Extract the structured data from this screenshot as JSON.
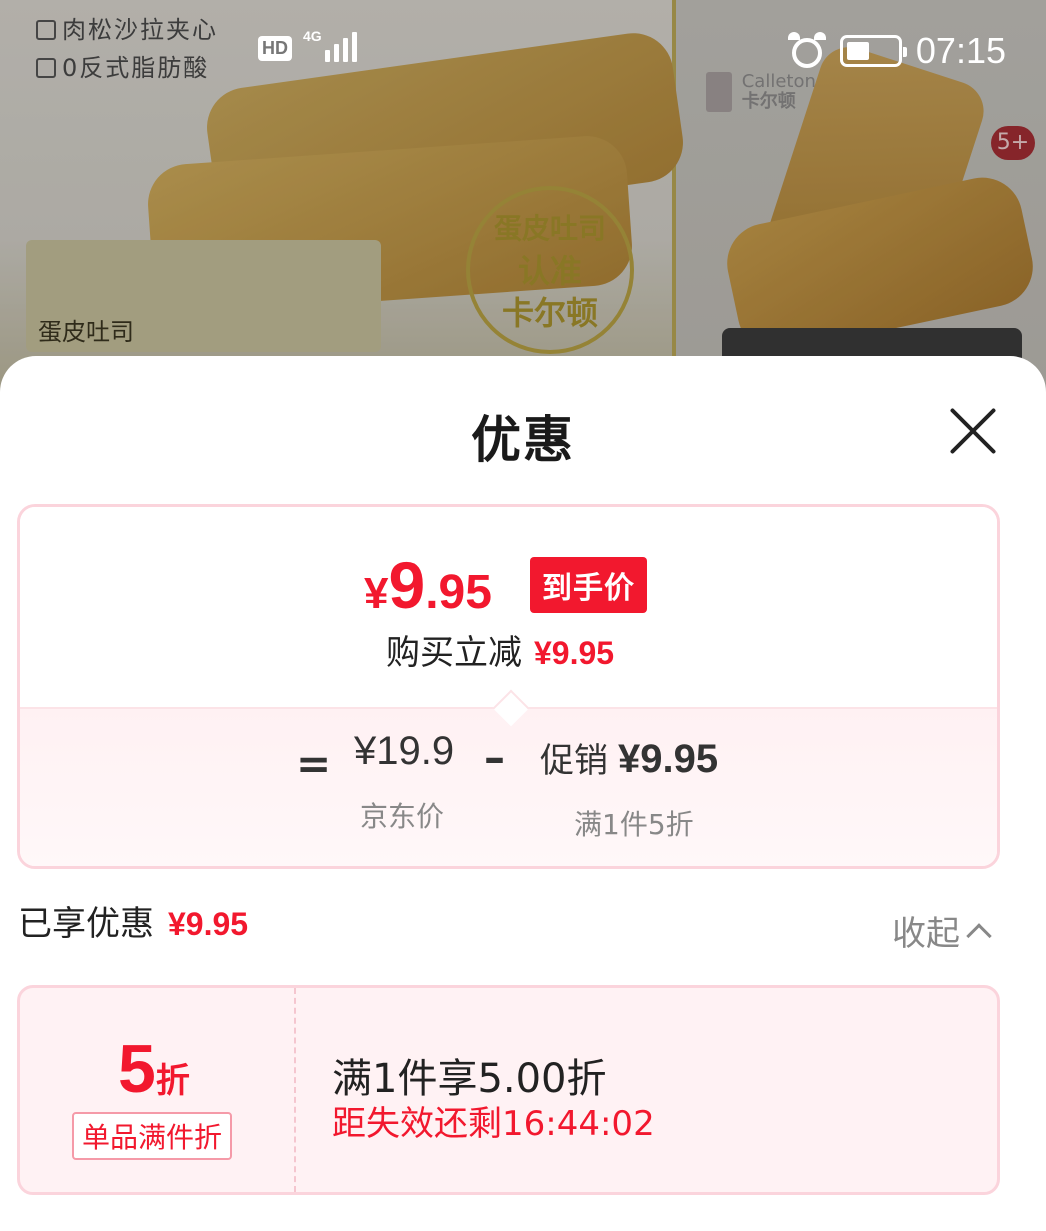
{
  "background": {
    "features": [
      "肉松沙拉夹心",
      "0反式脂肪酸"
    ],
    "box_label": "蛋皮吐司",
    "seal_lines": [
      "蛋皮吐司",
      "认准",
      "卡尔顿"
    ],
    "brand_en": "Calleton",
    "brand_cn": "卡尔顿",
    "image_count_badge": "5+"
  },
  "status_bar": {
    "hd": "HD",
    "network": "4G",
    "time": "07:15"
  },
  "sheet": {
    "title": "优惠",
    "price_card": {
      "final_currency": "¥",
      "final_int": "9",
      "final_dec": ".95",
      "final_tag": "到手价",
      "reduce_label": "购买立减",
      "reduce_amount": "¥9.95",
      "equals": "=",
      "jd_price": "¥19.9",
      "jd_label": "京东价",
      "minus": "–",
      "promo_label": "促销",
      "promo_amount": "¥9.95",
      "promo_rule": "满1件5折"
    },
    "enjoyed_label": "已享优惠",
    "enjoyed_amount": "¥9.95",
    "collapse_label": "收起",
    "coupon": {
      "discount_num": "5",
      "discount_unit": "折",
      "tag": "单品满件折",
      "description": "满1件享5.00折",
      "timer": "距失效还剩16:44:02"
    }
  },
  "colors": {
    "accent_red": "#f2182e",
    "card_border": "#fbd4dc"
  }
}
